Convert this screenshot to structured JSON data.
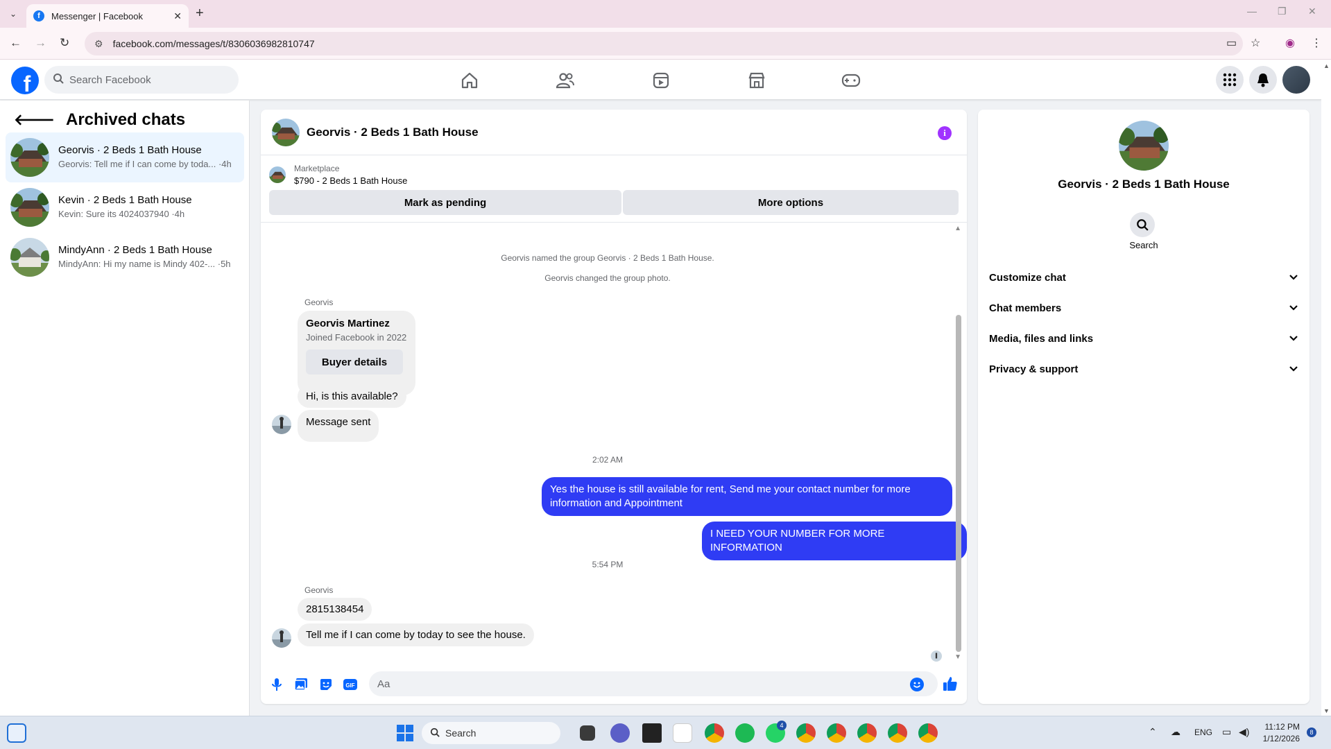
{
  "browser": {
    "tab_title": "Messenger | Facebook",
    "url": "facebook.com/messages/t/8306036982810747"
  },
  "facebook": {
    "search_placeholder": "Search Facebook"
  },
  "left_panel": {
    "title": "Archived chats",
    "chats": [
      {
        "name": "Georvis · 2 Beds 1 Bath House",
        "preview": "Georvis: Tell me if I can come by toda... ·4h",
        "active": true
      },
      {
        "name": "Kevin · 2 Beds 1 Bath House",
        "preview": "Kevin: Sure its 4024037940 ·4h",
        "active": false
      },
      {
        "name": "MindyAnn · 2 Beds 1 Bath House",
        "preview": "MindyAnn: Hi my name is Mindy 402-... ·5h",
        "active": false
      }
    ]
  },
  "chat": {
    "title": "Georvis · 2 Beds 1 Bath House",
    "marketplace_label": "Marketplace",
    "marketplace_item": "$790 - 2 Beds 1 Bath House",
    "mark_pending": "Mark as pending",
    "more_options": "More options",
    "system_messages": [
      "Georvis named the group Georvis · 2 Beds 1 Bath House.",
      "Georvis changed the group photo."
    ],
    "sender_name": "Georvis",
    "profile_card": {
      "name": "Georvis Martinez",
      "subtitle": "Joined Facebook in 2022",
      "button": "Buyer details"
    },
    "msg_available": "Hi, is this available?",
    "msg_sent": "Message sent",
    "time1": "2:02 AM",
    "out_msg1": "Yes the house is still available for rent, Send me your contact number for more information and Appointment",
    "out_msg2": "I NEED YOUR NUMBER FOR MORE INFORMATION",
    "time2": "5:54 PM",
    "msg_number": "2815138454",
    "msg_come_by": "Tell me if I can come by today to see the house.",
    "composer_placeholder": "Aa"
  },
  "right_panel": {
    "name": "Georvis · 2 Beds 1 Bath House",
    "search_label": "Search",
    "sections": [
      "Customize chat",
      "Chat members",
      "Media, files and links",
      "Privacy & support"
    ]
  },
  "taskbar": {
    "search_label": "Search",
    "language": "ENG",
    "time": "11:12 PM",
    "date": "1/12/2026",
    "notif_count": "8",
    "whatsapp_badge": "4"
  },
  "colors": {
    "fb_blue": "#0866ff",
    "outgoing_bubble": "#2f3cf4",
    "info_purple": "#a033ff"
  }
}
